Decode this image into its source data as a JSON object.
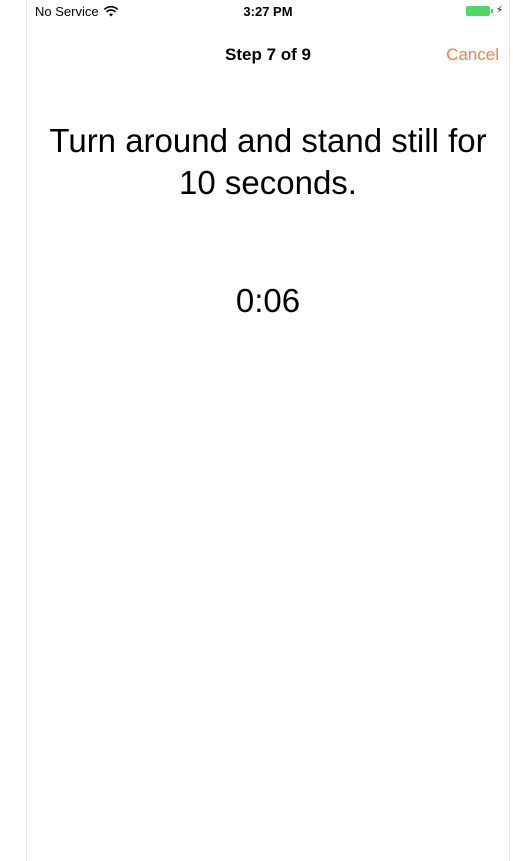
{
  "status_bar": {
    "carrier": "No Service",
    "time": "3:27 PM",
    "battery_color": "#4cd964"
  },
  "nav": {
    "title": "Step 7 of 9",
    "cancel_label": "Cancel",
    "accent_color": "#f77f4a"
  },
  "content": {
    "instruction": "Turn around and stand still for 10 seconds.",
    "timer": "0:06"
  }
}
